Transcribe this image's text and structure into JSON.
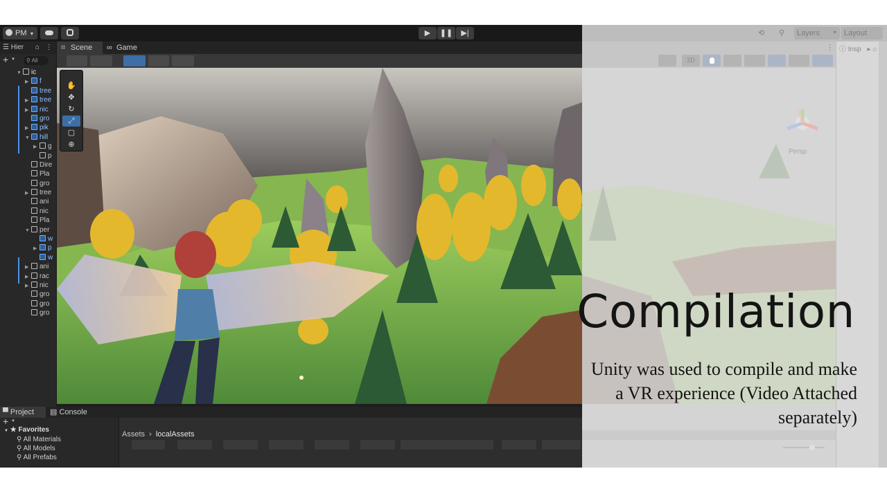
{
  "toolbar": {
    "account_label": "PM",
    "layers_label": "Layers",
    "layout_label": "Layout"
  },
  "hierarchy": {
    "tab_label": "Hier",
    "search_placeholder": "All",
    "items": [
      {
        "label": "ic",
        "indent": 0,
        "type": "scene",
        "arrow": "▼"
      },
      {
        "label": "f",
        "indent": 1,
        "type": "prefab",
        "arrow": "▶"
      },
      {
        "label": "tree",
        "indent": 1,
        "type": "prefab",
        "arrow": ""
      },
      {
        "label": "tree",
        "indent": 1,
        "type": "prefab",
        "arrow": "▶"
      },
      {
        "label": "nic",
        "indent": 1,
        "type": "prefab",
        "arrow": "▶"
      },
      {
        "label": "gro",
        "indent": 1,
        "type": "prefab",
        "arrow": ""
      },
      {
        "label": "pik",
        "indent": 1,
        "type": "prefab",
        "arrow": "▶"
      },
      {
        "label": "hill",
        "indent": 1,
        "type": "prefab",
        "arrow": "▼"
      },
      {
        "label": "g",
        "indent": 2,
        "type": "object",
        "arrow": "▶"
      },
      {
        "label": "p",
        "indent": 2,
        "type": "object",
        "arrow": ""
      },
      {
        "label": "Dire",
        "indent": 1,
        "type": "object",
        "arrow": ""
      },
      {
        "label": "Pla",
        "indent": 1,
        "type": "object",
        "arrow": ""
      },
      {
        "label": "gro",
        "indent": 1,
        "type": "object",
        "arrow": ""
      },
      {
        "label": "tree",
        "indent": 1,
        "type": "object",
        "arrow": "▶"
      },
      {
        "label": "ani",
        "indent": 1,
        "type": "object",
        "arrow": ""
      },
      {
        "label": "nic",
        "indent": 1,
        "type": "object",
        "arrow": ""
      },
      {
        "label": "Pla",
        "indent": 1,
        "type": "object",
        "arrow": ""
      },
      {
        "label": "per",
        "indent": 1,
        "type": "object",
        "arrow": "▼"
      },
      {
        "label": "w",
        "indent": 2,
        "type": "prefab",
        "arrow": ""
      },
      {
        "label": "p",
        "indent": 2,
        "type": "prefab",
        "arrow": "▶"
      },
      {
        "label": "w",
        "indent": 2,
        "type": "prefab",
        "arrow": ""
      },
      {
        "label": "ani",
        "indent": 1,
        "type": "object",
        "arrow": "▶"
      },
      {
        "label": "rac",
        "indent": 1,
        "type": "object",
        "arrow": "▶"
      },
      {
        "label": "nic",
        "indent": 1,
        "type": "object",
        "arrow": "▶"
      },
      {
        "label": "gro",
        "indent": 1,
        "type": "object",
        "arrow": ""
      },
      {
        "label": "gro",
        "indent": 1,
        "type": "object",
        "arrow": ""
      },
      {
        "label": "gro",
        "indent": 1,
        "type": "object",
        "arrow": ""
      }
    ]
  },
  "scene": {
    "tabs": [
      {
        "label": "Scene",
        "icon": "scene-grid-icon"
      },
      {
        "label": "Game",
        "icon": "gamepad-icon"
      }
    ],
    "mode_2d_label": "2D",
    "persp_label": "Persp",
    "tools": [
      "hand-tool-icon",
      "move-tool-icon",
      "rotate-tool-icon",
      "scale-tool-icon",
      "rect-tool-icon",
      "transform-tool-icon"
    ]
  },
  "project": {
    "tabs": [
      {
        "label": "Project",
        "icon": "folder-icon"
      },
      {
        "label": "Console",
        "icon": "console-icon"
      }
    ],
    "favorites_label": "Favorites",
    "favorites": [
      "All Materials",
      "All Models",
      "All Prefabs"
    ],
    "breadcrumb": [
      "Assets",
      "localAssets"
    ]
  },
  "inspector": {
    "tab_label": "Insp"
  },
  "slide": {
    "heading": "Compilation",
    "body": "Unity was used to compile and make a VR experience (Video Attached separately)"
  },
  "colors": {
    "selection_blue": "#3d6ea8",
    "prefab_blue": "#8fc1ff",
    "editor_dark": "#282828"
  }
}
